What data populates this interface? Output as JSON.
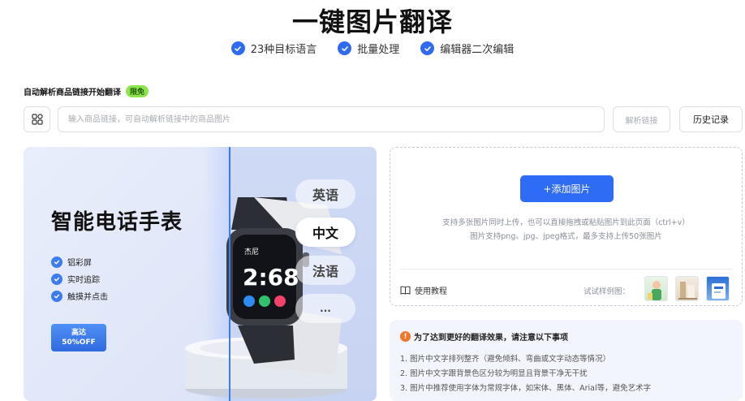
{
  "page": {
    "title": "一键图片翻译",
    "features": [
      "23种目标语言",
      "批量处理",
      "编辑器二次编辑"
    ]
  },
  "link_parser": {
    "label": "自动解析商品链接开始翻译",
    "badge": "限免",
    "placeholder": "输入商品链接，可自动解析链接中的商品图片",
    "parse_button": "解析链接",
    "history_button": "历史记录"
  },
  "preview": {
    "promo_title": "智能电话手表",
    "promo_features": [
      "铝彩屏",
      "实时追踪",
      "触摸并点击"
    ],
    "promo_badge_line1": "高达",
    "promo_badge_line2": "50%OFF",
    "watch_name": "杰尼",
    "watch_time": "2:68",
    "languages": [
      {
        "label": "英语",
        "active": false
      },
      {
        "label": "中文",
        "active": true
      },
      {
        "label": "法语",
        "active": false
      },
      {
        "label": "...",
        "active": false
      }
    ]
  },
  "upload": {
    "add_button": "+添加图片",
    "hint_line1": "支持多张图片同时上传，也可以直接拖拽或粘贴图片到此页面（ctrl+v）",
    "hint_line2": "图片支持png、jpg、jpeg格式，最多支持上传50张图片",
    "tutorial": "使用教程",
    "try_samples": "试试样例图："
  },
  "tips": {
    "title": "为了达到更好的翻译效果，请注意以下事项",
    "items": [
      "1. 图片中文字排列整齐（避免倾斜、弯曲或文字动态等情况）",
      "2. 图片中文字跟背景色区分较为明显且背景干净无干扰",
      "3. 图片中推荐使用字体为常规字体，如宋体、黑体、Arial等，避免艺术字"
    ]
  },
  "colors": {
    "accent": "#2e6cf6",
    "badge_green": "#8ee44b",
    "warning": "#f0762b"
  }
}
